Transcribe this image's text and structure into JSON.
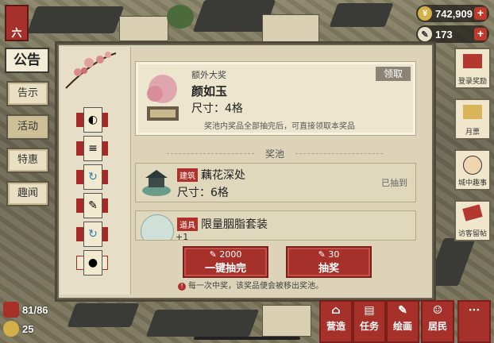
{
  "resources": {
    "coins": "742,909",
    "tokens": "173",
    "plus": "+"
  },
  "top_left_badge": "六",
  "left_tabs": {
    "title": "公告",
    "items": [
      {
        "label": "告示",
        "active": false
      },
      {
        "label": "活动",
        "active": true
      },
      {
        "label": "特惠",
        "active": false
      },
      {
        "label": "趣闻",
        "active": false
      }
    ]
  },
  "grand_prize": {
    "heading": "额外大奖",
    "name": "颜如玉",
    "size": "尺寸：4格",
    "description": "奖池内奖品全部抽完后，可直接领取本奖品",
    "claim_button": "领取"
  },
  "pool_label": "奖池",
  "pool_items": [
    {
      "tag": "建筑",
      "name": "藕花深处",
      "size": "尺寸：6格",
      "status": "已抽到"
    },
    {
      "tag": "道具",
      "name": "限量胭脂套装",
      "extra": "+1"
    }
  ],
  "draw_all_button": {
    "cost": "2000",
    "label": "一键抽完"
  },
  "draw_button": {
    "cost": "30",
    "label": "抽奖"
  },
  "footer_note": "每一次中奖，该奖品便会被移出奖池。",
  "note_icon": "!",
  "right_buttons": [
    {
      "label": "登录奖励",
      "icon": "gift-box-icon"
    },
    {
      "label": "月票",
      "icon": "ticket-icon"
    },
    {
      "label": "城中趣事",
      "icon": "face-icon"
    },
    {
      "label": "访客留帖",
      "icon": "letter-icon"
    }
  ],
  "bottom_stats": {
    "population": "81/86",
    "coins_small": "25"
  },
  "bottom_nav": [
    {
      "label": "营造",
      "icon": "build-icon"
    },
    {
      "label": "任务",
      "icon": "task-icon"
    },
    {
      "label": "绘画",
      "icon": "paint-icon"
    },
    {
      "label": "居民",
      "icon": "resident-icon"
    },
    {
      "label": "···",
      "icon": "more-icon"
    }
  ],
  "colors": {
    "accent_red": "#a6302a",
    "panel_bg": "#dcd3b8",
    "card_bg": "#ede6cf"
  }
}
